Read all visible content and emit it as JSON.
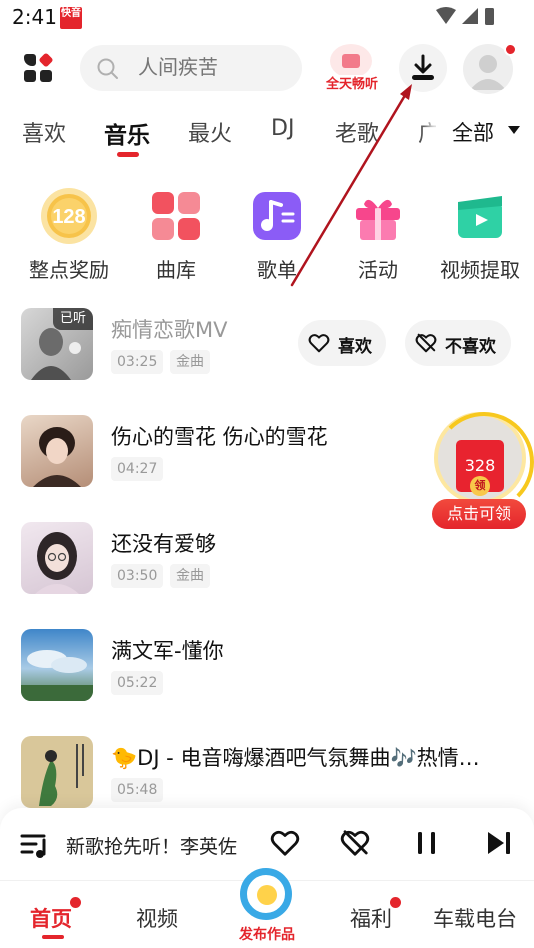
{
  "status_bar": {
    "time": "2:41",
    "app_badge": "快音"
  },
  "header": {
    "search_placeholder": "人间疾苦",
    "allday_label": "全天畅听"
  },
  "tabs": [
    "喜欢",
    "音乐",
    "最火",
    "DJ",
    "老歌",
    "广"
  ],
  "active_tab": "音乐",
  "tab_all_label": "全部",
  "quick_entries": [
    {
      "label": "整点奖励",
      "icon": "coin-128-icon",
      "badge": "128"
    },
    {
      "label": "曲库",
      "icon": "library-icon"
    },
    {
      "label": "歌单",
      "icon": "playlist-icon"
    },
    {
      "label": "活动",
      "icon": "gift-icon"
    },
    {
      "label": "视频提取",
      "icon": "video-extract-icon"
    }
  ],
  "songs": [
    {
      "title": "痴情恋歌MV",
      "duration": "03:25",
      "tag": "金曲",
      "listened_badge": "已听",
      "like_label": "喜欢",
      "dislike_label": "不喜欢"
    },
    {
      "title": "伤心的雪花 伤心的雪花",
      "duration": "04:27"
    },
    {
      "title": "还没有爱够",
      "duration": "03:50",
      "tag": "金曲"
    },
    {
      "title": "满文军-懂你",
      "duration": "05:22"
    },
    {
      "title": "🐤DJ - 电音嗨爆酒吧气氛舞曲🎶热情…",
      "duration": "05:48"
    }
  ],
  "red_packet": {
    "amount": "328",
    "seal": "领",
    "label": "点击可领"
  },
  "player": {
    "now_playing": "新歌抢先听！李英佐"
  },
  "bottom_nav": {
    "home": "首页",
    "video": "视频",
    "publish": "发布作品",
    "welfare": "福利",
    "car_radio": "车载电台"
  },
  "colors": {
    "accent": "#e4252c",
    "annotation_arrow": "#b0141e"
  }
}
